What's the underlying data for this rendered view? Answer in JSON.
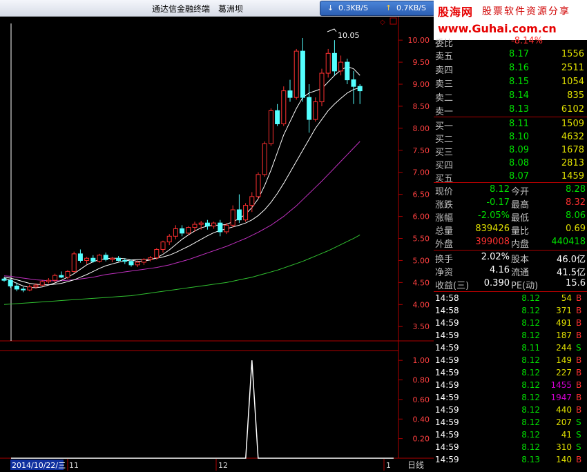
{
  "window": {
    "title": "通达信金融终端",
    "stock_name": "葛洲坝",
    "net_down": "0.3KB/S",
    "net_up": "0.7KB/S"
  },
  "logo": {
    "brand": "股海网",
    "slogan": "股票软件资源分享",
    "url": "www.Guhai.com.cn"
  },
  "chart_labels": {
    "date": "2014/10/22/三",
    "month1": "11",
    "month2": "12",
    "month3": "1",
    "period": "日线",
    "high_mark": "10.05",
    "price_axis": [
      "10.00",
      "9.50",
      "9.00",
      "8.50",
      "8.00",
      "7.50",
      "7.00",
      "6.50",
      "6.00",
      "5.50",
      "5.00",
      "4.50",
      "4.00",
      "3.50"
    ],
    "vol_axis": [
      "1.00",
      "0.80",
      "0.60",
      "0.40",
      "0.20"
    ]
  },
  "chart_data": {
    "type": "candlestick",
    "ylim": [
      3.3,
      10.3
    ],
    "candles": [
      [
        4.58,
        4.62,
        4.52,
        4.55
      ],
      [
        4.55,
        4.58,
        4.38,
        4.42
      ],
      [
        4.42,
        4.5,
        4.3,
        4.35
      ],
      [
        4.35,
        4.4,
        4.28,
        4.33
      ],
      [
        4.33,
        4.45,
        4.3,
        4.4
      ],
      [
        4.4,
        4.48,
        4.36,
        4.44
      ],
      [
        4.44,
        4.55,
        4.42,
        4.52
      ],
      [
        4.52,
        4.6,
        4.48,
        4.55
      ],
      [
        4.55,
        4.7,
        4.5,
        4.66
      ],
      [
        4.66,
        4.75,
        4.6,
        4.62
      ],
      [
        4.62,
        4.78,
        4.58,
        4.75
      ],
      [
        4.75,
        5.2,
        4.72,
        5.15
      ],
      [
        5.15,
        5.25,
        4.95,
        5.0
      ],
      [
        5.0,
        5.08,
        4.92,
        5.05
      ],
      [
        5.05,
        5.12,
        4.95,
        4.98
      ],
      [
        4.98,
        5.15,
        4.95,
        5.12
      ],
      [
        5.12,
        5.18,
        4.98,
        5.02
      ],
      [
        5.02,
        5.08,
        4.96,
        5.05
      ],
      [
        5.05,
        5.1,
        4.98,
        5.0
      ],
      [
        5.0,
        5.05,
        4.92,
        4.98
      ],
      [
        4.98,
        5.02,
        4.86,
        4.9
      ],
      [
        4.9,
        5.0,
        4.85,
        4.96
      ],
      [
        4.96,
        5.05,
        4.9,
        5.02
      ],
      [
        5.02,
        5.1,
        4.98,
        5.06
      ],
      [
        5.06,
        5.28,
        5.02,
        5.25
      ],
      [
        5.25,
        5.45,
        5.18,
        5.42
      ],
      [
        5.42,
        5.6,
        5.35,
        5.55
      ],
      [
        5.55,
        5.8,
        5.48,
        5.72
      ],
      [
        5.72,
        5.8,
        5.55,
        5.62
      ],
      [
        5.62,
        5.78,
        5.58,
        5.75
      ],
      [
        5.75,
        5.88,
        5.65,
        5.82
      ],
      [
        5.82,
        5.9,
        5.7,
        5.85
      ],
      [
        5.85,
        5.92,
        5.7,
        5.78
      ],
      [
        5.78,
        5.88,
        5.72,
        5.85
      ],
      [
        5.85,
        5.92,
        5.55,
        5.65
      ],
      [
        5.65,
        5.85,
        5.6,
        5.8
      ],
      [
        5.8,
        6.25,
        5.75,
        6.15
      ],
      [
        6.15,
        6.5,
        5.85,
        5.92
      ],
      [
        5.92,
        6.3,
        5.88,
        6.25
      ],
      [
        6.25,
        6.55,
        6.1,
        6.45
      ],
      [
        6.45,
        7.0,
        6.4,
        6.95
      ],
      [
        6.95,
        7.7,
        6.9,
        7.65
      ],
      [
        7.65,
        8.45,
        7.6,
        8.4
      ],
      [
        8.4,
        8.55,
        8.05,
        8.1
      ],
      [
        8.1,
        8.95,
        8.05,
        8.85
      ],
      [
        8.85,
        9.1,
        8.6,
        8.7
      ],
      [
        8.7,
        9.8,
        8.65,
        9.75
      ],
      [
        9.75,
        10.05,
        8.6,
        8.7
      ],
      [
        8.7,
        9.0,
        7.9,
        8.2
      ],
      [
        8.2,
        8.7,
        8.15,
        8.6
      ],
      [
        8.6,
        9.35,
        8.5,
        9.25
      ],
      [
        9.25,
        9.8,
        9.15,
        9.7
      ],
      [
        9.7,
        10.0,
        9.2,
        9.3
      ],
      [
        9.3,
        9.65,
        9.2,
        9.5
      ],
      [
        9.5,
        9.58,
        9.0,
        9.1
      ],
      [
        9.1,
        9.3,
        8.55,
        8.95
      ],
      [
        8.95,
        9.0,
        8.55,
        8.85
      ]
    ],
    "ma5": [
      4.6,
      4.55,
      4.48,
      4.42,
      4.39,
      4.38,
      4.4,
      4.44,
      4.49,
      4.55,
      4.62,
      4.7,
      4.8,
      4.9,
      4.97,
      5.02,
      5.04,
      5.05,
      5.05,
      5.04,
      5.01,
      4.98,
      4.99,
      5.01,
      5.06,
      5.14,
      5.24,
      5.36,
      5.48,
      5.58,
      5.67,
      5.74,
      5.78,
      5.8,
      5.8,
      5.82,
      5.88,
      5.95,
      6.05,
      6.2,
      6.4,
      6.7,
      7.05,
      7.45,
      7.85,
      8.15,
      8.45,
      8.7,
      8.8,
      8.85,
      8.9,
      9.05,
      9.2,
      9.32,
      9.4,
      9.35,
      9.2
    ],
    "ma10": [
      4.62,
      4.6,
      4.56,
      4.52,
      4.48,
      4.46,
      4.45,
      4.45,
      4.46,
      4.48,
      4.52,
      4.56,
      4.62,
      4.68,
      4.75,
      4.82,
      4.88,
      4.92,
      4.96,
      4.99,
      5.01,
      5.02,
      5.02,
      5.03,
      5.05,
      5.08,
      5.12,
      5.18,
      5.25,
      5.32,
      5.4,
      5.48,
      5.56,
      5.63,
      5.68,
      5.72,
      5.76,
      5.8,
      5.85,
      5.92,
      6.02,
      6.15,
      6.32,
      6.52,
      6.75,
      7.0,
      7.25,
      7.5,
      7.75,
      8.0,
      8.2,
      8.4,
      8.55,
      8.68,
      8.8,
      8.88,
      8.92
    ],
    "ma20": [
      4.65,
      4.64,
      4.62,
      4.6,
      4.58,
      4.56,
      4.55,
      4.54,
      4.54,
      4.54,
      4.55,
      4.56,
      4.58,
      4.6,
      4.62,
      4.65,
      4.68,
      4.7,
      4.72,
      4.74,
      4.76,
      4.78,
      4.8,
      4.82,
      4.84,
      4.87,
      4.9,
      4.94,
      4.98,
      5.02,
      5.07,
      5.12,
      5.17,
      5.22,
      5.27,
      5.32,
      5.38,
      5.44,
      5.5,
      5.57,
      5.64,
      5.72,
      5.8,
      5.9,
      6.0,
      6.12,
      6.24,
      6.38,
      6.52,
      6.66,
      6.8,
      6.95,
      7.1,
      7.25,
      7.4,
      7.55,
      7.7
    ],
    "ma60": [
      4.0,
      4.01,
      4.02,
      4.03,
      4.04,
      4.05,
      4.06,
      4.07,
      4.08,
      4.09,
      4.1,
      4.11,
      4.12,
      4.13,
      4.14,
      4.15,
      4.16,
      4.17,
      4.18,
      4.19,
      4.2,
      4.22,
      4.24,
      4.26,
      4.28,
      4.3,
      4.32,
      4.34,
      4.36,
      4.38,
      4.4,
      4.42,
      4.44,
      4.46,
      4.48,
      4.5,
      4.53,
      4.56,
      4.59,
      4.62,
      4.66,
      4.7,
      4.74,
      4.78,
      4.83,
      4.88,
      4.93,
      4.98,
      5.04,
      5.1,
      5.16,
      5.22,
      5.29,
      5.36,
      5.43,
      5.5,
      5.58
    ],
    "indicator": {
      "ylim": [
        0,
        1.1
      ],
      "spike_index": 39,
      "spike_value": 1.0
    }
  },
  "quote": {
    "ask": [
      {
        "label": "卖五",
        "price": "8.17",
        "vol": "1556"
      },
      {
        "label": "卖四",
        "price": "8.16",
        "vol": "2511"
      },
      {
        "label": "卖三",
        "price": "8.15",
        "vol": "1054"
      },
      {
        "label": "卖二",
        "price": "8.14",
        "vol": "835"
      },
      {
        "label": "卖一",
        "price": "8.13",
        "vol": "6102"
      }
    ],
    "bid": [
      {
        "label": "买一",
        "price": "8.11",
        "vol": "1509"
      },
      {
        "label": "买二",
        "price": "8.10",
        "vol": "4632"
      },
      {
        "label": "买三",
        "price": "8.09",
        "vol": "1678"
      },
      {
        "label": "买四",
        "price": "8.08",
        "vol": "2813"
      },
      {
        "label": "买五",
        "price": "8.07",
        "vol": "1459"
      }
    ],
    "stats": [
      {
        "l1": "现价",
        "v1": "8.12",
        "c1": "#00e000",
        "l2": "今开",
        "v2": "8.28",
        "c2": "#00e000"
      },
      {
        "l1": "涨跌",
        "v1": "-0.17",
        "c1": "#00e000",
        "l2": "最高",
        "v2": "8.32",
        "c2": "#ff3030"
      },
      {
        "l1": "涨幅",
        "v1": "-2.05%",
        "c1": "#00e000",
        "l2": "最低",
        "v2": "8.06",
        "c2": "#00e000"
      },
      {
        "l1": "总量",
        "v1": "839426",
        "c1": "#e0e000",
        "l2": "量比",
        "v2": "0.69",
        "c2": "#e0e000"
      },
      {
        "l1": "外盘",
        "v1": "399008",
        "c1": "#ff3030",
        "l2": "内盘",
        "v2": "440418",
        "c2": "#00e000"
      }
    ],
    "fund": [
      {
        "l1": "换手",
        "v1": "2.02%",
        "l2": "股本",
        "v2": "46.0亿"
      },
      {
        "l1": "净资",
        "v1": "4.16",
        "l2": "流通",
        "v2": "41.5亿"
      },
      {
        "l1": "收益(三)",
        "v1": "0.390",
        "l2": "PE(动)",
        "v2": "15.6"
      }
    ]
  },
  "ticks": [
    {
      "time": "14:58",
      "price": "8.12",
      "vol": "54",
      "side": "B",
      "vc": "#e0e000"
    },
    {
      "time": "14:58",
      "price": "8.12",
      "vol": "371",
      "side": "B",
      "vc": "#e0e000"
    },
    {
      "time": "14:59",
      "price": "8.12",
      "vol": "491",
      "side": "B",
      "vc": "#e0e000"
    },
    {
      "time": "14:59",
      "price": "8.12",
      "vol": "187",
      "side": "B",
      "vc": "#e0e000"
    },
    {
      "time": "14:59",
      "price": "8.11",
      "vol": "244",
      "side": "S",
      "vc": "#e0e000"
    },
    {
      "time": "14:59",
      "price": "8.12",
      "vol": "149",
      "side": "B",
      "vc": "#e0e000"
    },
    {
      "time": "14:59",
      "price": "8.12",
      "vol": "227",
      "side": "B",
      "vc": "#e0e000"
    },
    {
      "time": "14:59",
      "price": "8.12",
      "vol": "1455",
      "side": "B",
      "vc": "#d000d0"
    },
    {
      "time": "14:59",
      "price": "8.12",
      "vol": "1947",
      "side": "B",
      "vc": "#d000d0"
    },
    {
      "time": "14:59",
      "price": "8.12",
      "vol": "440",
      "side": "B",
      "vc": "#e0e000"
    },
    {
      "time": "14:59",
      "price": "8.12",
      "vol": "207",
      "side": "S",
      "vc": "#e0e000"
    },
    {
      "time": "14:59",
      "price": "8.12",
      "vol": "41",
      "side": "S",
      "vc": "#e0e000"
    },
    {
      "time": "14:59",
      "price": "8.12",
      "vol": "310",
      "side": "S",
      "vc": "#e0e000"
    },
    {
      "time": "14:59",
      "price": "8.13",
      "vol": "140",
      "side": "B",
      "vc": "#e0e000"
    }
  ]
}
